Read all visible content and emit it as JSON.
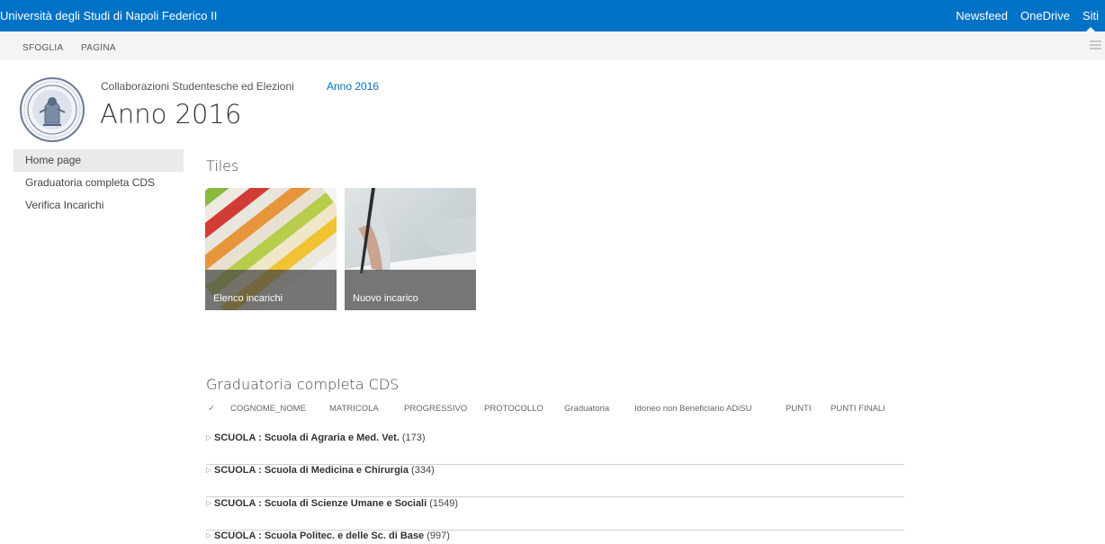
{
  "suite_bar": {
    "title": "Università degli Studi di Napoli Federico II",
    "links": [
      "Newsfeed",
      "OneDrive",
      "Siti"
    ]
  },
  "ribbon": {
    "tabs": [
      "SFOGLIA",
      "PAGINA"
    ]
  },
  "header": {
    "breadcrumb_parent": "Collaborazioni Studentesche ed Elezioni",
    "breadcrumb_current": "Anno 2016",
    "page_title": "Anno 2016"
  },
  "quick_launch": {
    "items": [
      "Home page",
      "Graduatoria completa CDS",
      "Verifica Incarichi"
    ]
  },
  "tiles": {
    "heading": "Tiles",
    "items": [
      "Elenco incarichi",
      "Nuovo incarico"
    ]
  },
  "list": {
    "heading": "Graduatoria completa CDS",
    "columns": [
      "COGNOME_NOME",
      "MATRICOLA",
      "PROGRESSIVO",
      "PROTOCOLLO",
      "Graduatoria",
      "Idoneo non Beneficiario ADiSU",
      "PUNTI",
      "PUNTI FINALI"
    ],
    "groups": [
      {
        "field": "SCUOLA :",
        "value": "Scuola di Agraria e Med. Vet.",
        "count": "(173)"
      },
      {
        "field": "SCUOLA :",
        "value": "Scuola di Medicina e Chirurgia",
        "count": "(334)"
      },
      {
        "field": "SCUOLA :",
        "value": "Scuola di Scienze Umane e Sociali",
        "count": "(1549)"
      },
      {
        "field": "SCUOLA :",
        "value": "Scuola Politec. e delle Sc. di Base",
        "count": "(997)"
      }
    ]
  },
  "colors": {
    "suite_bar": "#0072c6",
    "link": "#0072c6"
  }
}
